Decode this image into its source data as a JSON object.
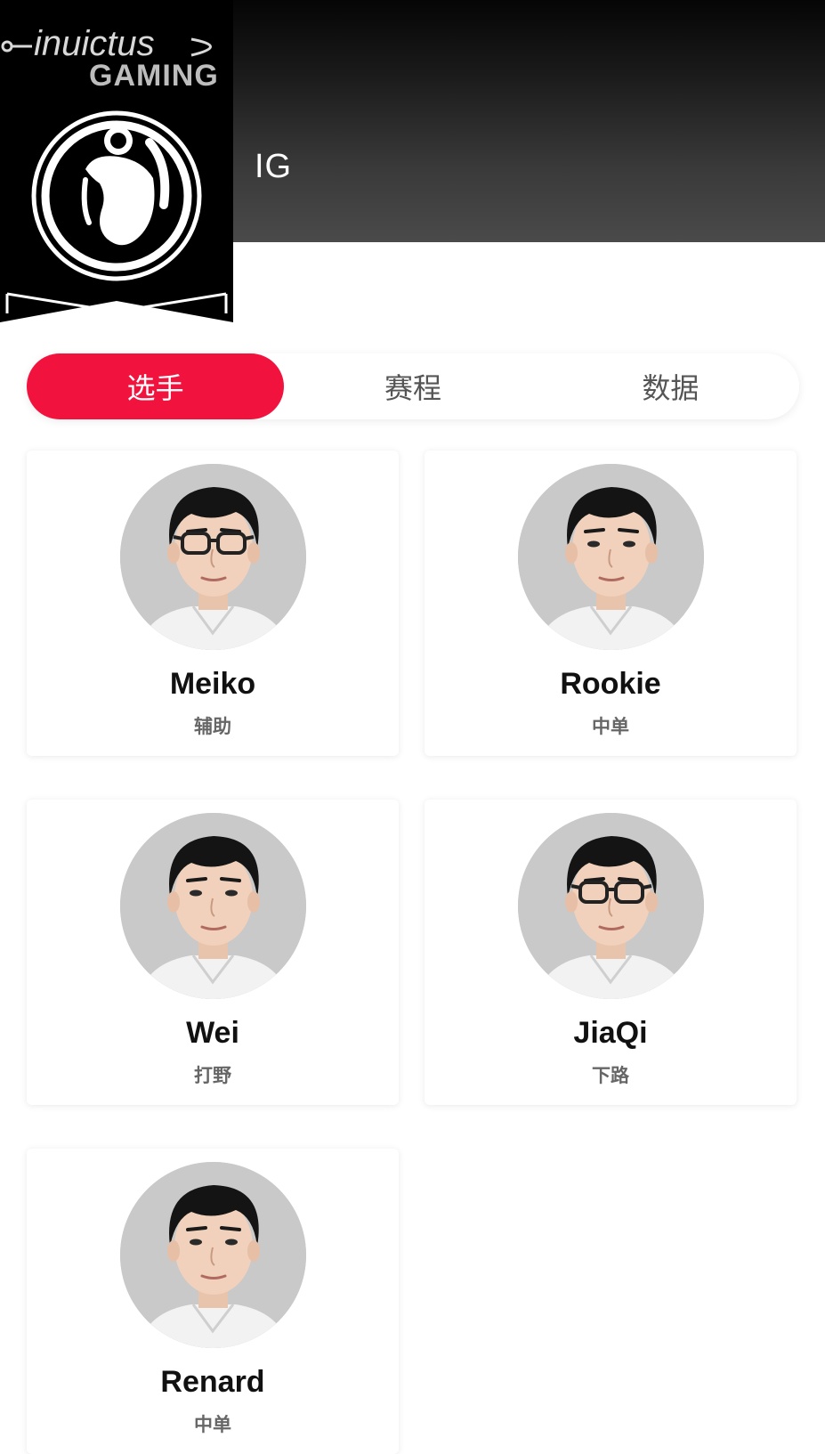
{
  "team": {
    "name": "IG",
    "logo_text_line1": "inuictus",
    "logo_text_line2": "GAMING"
  },
  "tabs": [
    {
      "label": "选手",
      "active": true
    },
    {
      "label": "赛程",
      "active": false
    },
    {
      "label": "数据",
      "active": false
    }
  ],
  "players": [
    {
      "name": "Meiko",
      "role": "辅助",
      "glasses": true
    },
    {
      "name": "Rookie",
      "role": "中单",
      "glasses": false
    },
    {
      "name": "Wei",
      "role": "打野",
      "glasses": false
    },
    {
      "name": "JiaQi",
      "role": "下路",
      "glasses": true
    },
    {
      "name": "Renard",
      "role": "中单",
      "glasses": false
    }
  ],
  "colors": {
    "accent": "#f2123e",
    "header_dark": "#050505",
    "header_light": "#4a4a4a",
    "avatar_bg": "#c9c9c9"
  }
}
